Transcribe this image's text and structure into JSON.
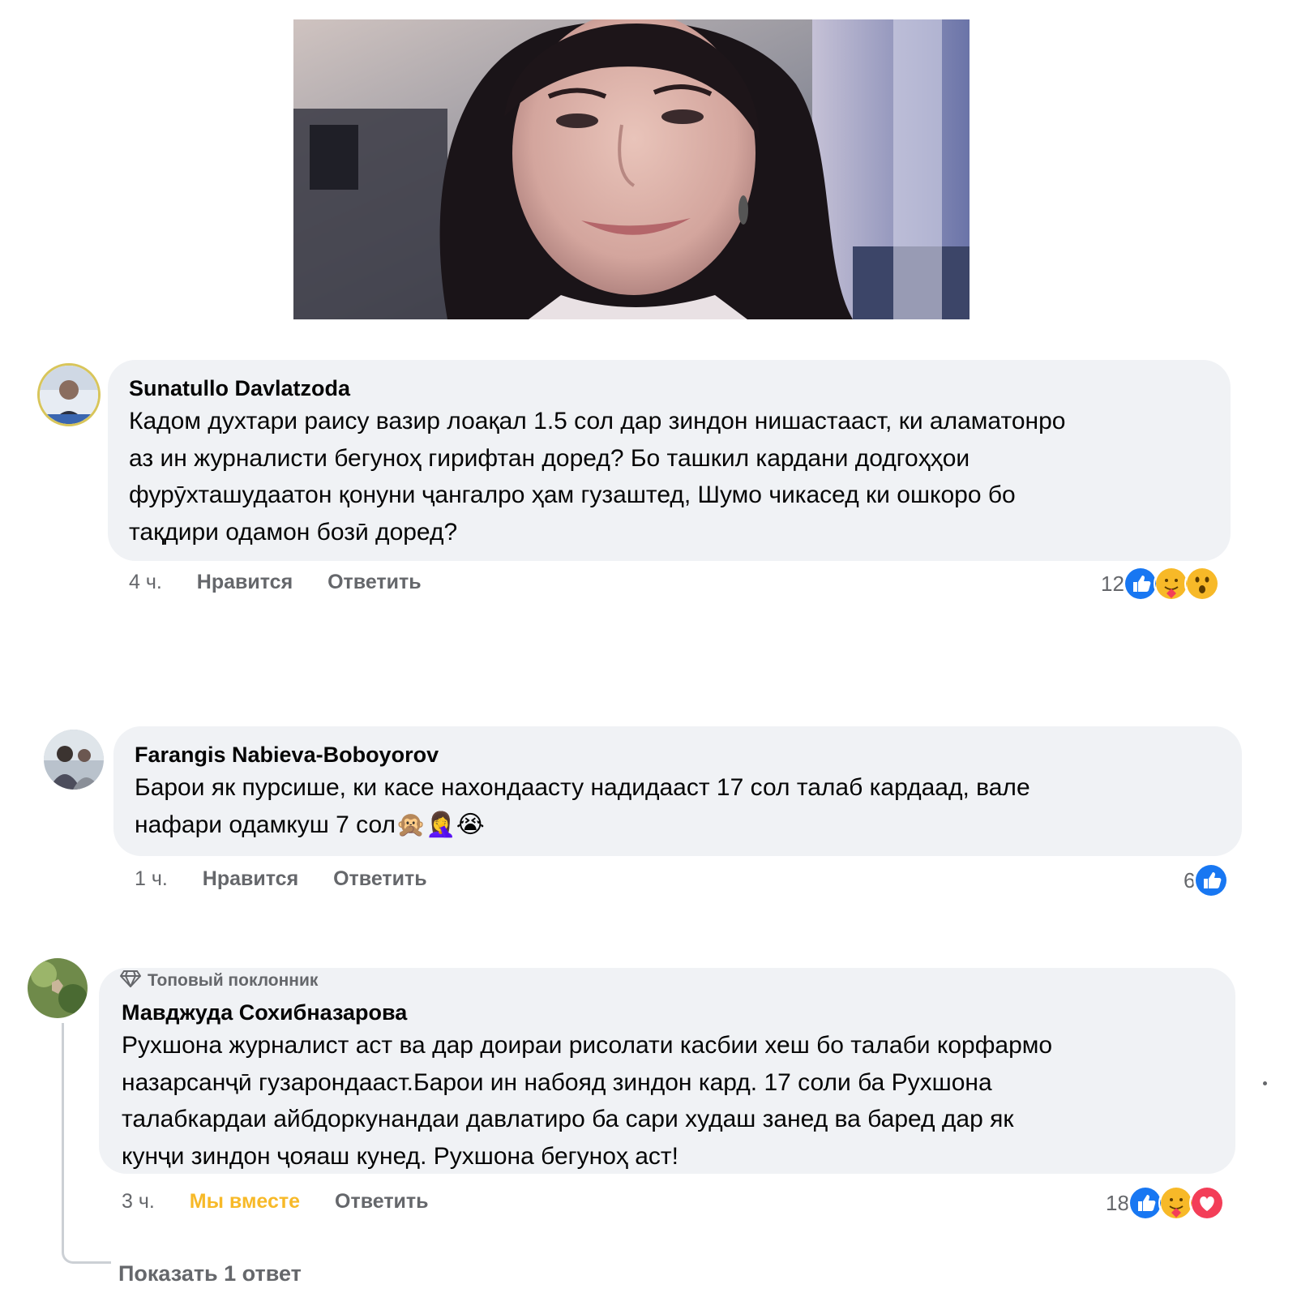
{
  "comments": [
    {
      "author": "Sunatullo Davlatzoda",
      "lines": [
        "Кадом духтари раису вазир лоақал 1.5 сол дар зиндон нишастааст, ки аламатонро",
        "аз ин журналисти бегуноҳ гирифтан доред? Бо ташкил кардани додгоҳҳои",
        "фурӯхташудаатон қонуни ҷангалро ҳам гузаштед, Шумо чикасед ки ошкоро бо",
        "тақдири одамон бозӣ доред?"
      ],
      "time": "4 ч.",
      "like_label": "Нравится",
      "reply_label": "Ответить",
      "reaction_count": "12",
      "reactions": [
        "like",
        "care",
        "wow"
      ]
    },
    {
      "author": "Farangis Nabieva-Boboyorov",
      "lines": [
        "Барои як пурсише, ки касе нахондаасту надидааст 17 сол талаб кардаад, вале",
        "нафари одамкуш 7 сол"
      ],
      "emoji": "🙊🤦‍♀️😭",
      "time": "1 ч.",
      "like_label": "Нравится",
      "reply_label": "Ответить",
      "reaction_count": "6",
      "reactions": [
        "like"
      ]
    },
    {
      "badge": "Топовый поклонник",
      "author": "Мавджуда Сохибназарова",
      "lines": [
        "Рухшона журналист аст ва дар доираи рисолати касбии хеш бо талаби корфармо",
        "назарсанҷӣ гузарондааст.Барои ин набояд зиндон кард. 17 соли ба Рухшона",
        "талабкардаи айбдоркунандаи давлатиро ба сари худаш занед ва баред дар як",
        "кунҷи зиндон ҷояаш кунед. Рухшона бегуноҳ аст!"
      ],
      "time": "3 ч.",
      "like_label": "Мы вместе",
      "reply_label": "Ответить",
      "reaction_count": "18",
      "reactions": [
        "like",
        "care",
        "love"
      ],
      "show_replies": "Показать 1 ответ"
    }
  ],
  "colors": {
    "bubble": "#f0f2f5",
    "meta_text": "#65676b",
    "like_blue": "#1877f2",
    "care_yellow": "#f7b928",
    "love_red": "#f33e58"
  },
  "icons": [
    "photo-portrait",
    "avatar",
    "like-reaction-icon",
    "care-reaction-icon",
    "wow-reaction-icon",
    "love-reaction-icon",
    "diamond-icon"
  ]
}
